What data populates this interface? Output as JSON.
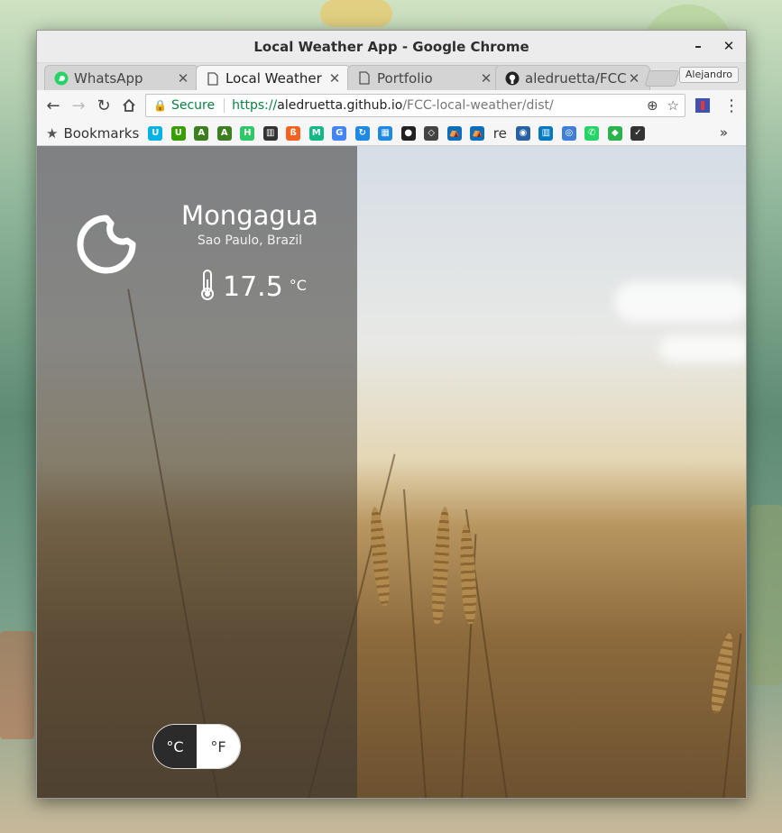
{
  "window": {
    "title": "Local Weather App - Google Chrome",
    "minimize_glyph": "–",
    "close_glyph": "✕"
  },
  "tabs": [
    {
      "label": "WhatsApp",
      "icon": "whatsapp-icon",
      "active": false
    },
    {
      "label": "Local Weather",
      "icon": "page-icon",
      "active": true
    },
    {
      "label": "Portfolio",
      "icon": "page-icon",
      "active": false
    },
    {
      "label": "aledruetta/FCC",
      "icon": "github-icon",
      "active": false
    }
  ],
  "profile_name": "Alejandro",
  "omnibox": {
    "secure_label": "Secure",
    "scheme": "https://",
    "host": "aledruetta.github.io",
    "path": "/FCC-local-weather/dist/"
  },
  "bookmarks": {
    "label": "Bookmarks",
    "reading_item": "re",
    "icons": [
      {
        "name": "udacity-bookmark-icon",
        "color": "#02b3e4",
        "glyph": "U"
      },
      {
        "name": "upwork-bookmark-icon",
        "color": "#37a000",
        "glyph": "U"
      },
      {
        "name": "android-bookmark-icon",
        "color": "#3b7f1f",
        "glyph": "A"
      },
      {
        "name": "android-bookmark-icon-2",
        "color": "#3b7f1f",
        "glyph": "A"
      },
      {
        "name": "hackerrank-bookmark-icon",
        "color": "#2ec866",
        "glyph": "H"
      },
      {
        "name": "app-bookmark-icon",
        "color": "#333333",
        "glyph": "▥"
      },
      {
        "name": "orange-bookmark-icon",
        "color": "#f26322",
        "glyph": "ß"
      },
      {
        "name": "medium-bookmark-icon",
        "color": "#12b886",
        "glyph": "M"
      },
      {
        "name": "translate-bookmark-icon",
        "color": "#4285f4",
        "glyph": "G"
      },
      {
        "name": "sync-bookmark-icon",
        "color": "#1e88e5",
        "glyph": "↻"
      },
      {
        "name": "layout-bookmark-icon",
        "color": "#1e88e5",
        "glyph": "▦"
      },
      {
        "name": "github-bookmark-icon",
        "color": "#222222",
        "glyph": "●"
      },
      {
        "name": "codepen-bookmark-icon",
        "color": "#444444",
        "glyph": "◇"
      },
      {
        "name": "freecodecamp-bookmark-icon",
        "color": "#0a6ebd",
        "glyph": "⛺"
      },
      {
        "name": "freecodecamp-bookmark-icon-2",
        "color": "#0a6ebd",
        "glyph": "⛺"
      }
    ],
    "icons_after": [
      {
        "name": "bucket-bookmark-icon",
        "color": "#2962a0",
        "glyph": "◉"
      },
      {
        "name": "trello-bookmark-icon",
        "color": "#0079bf",
        "glyph": "▥"
      },
      {
        "name": "globe-bookmark-icon",
        "color": "#3f7fd8",
        "glyph": "◎"
      },
      {
        "name": "whatsapp-bookmark-icon",
        "color": "#25d366",
        "glyph": "✆"
      },
      {
        "name": "feedly-bookmark-icon",
        "color": "#2bb24c",
        "glyph": "◆"
      },
      {
        "name": "bird-bookmark-icon",
        "color": "#333333",
        "glyph": "✓"
      }
    ],
    "more_glyph": "»"
  },
  "weather": {
    "city": "Mongagua",
    "region": "Sao Paulo, Brazil",
    "temperature": "17.5",
    "unit": "°C",
    "condition_icon": "night-moon-icon"
  },
  "unit_toggle": {
    "celsius_label": "°C",
    "fahrenheit_label": "°F",
    "selected": "celsius"
  },
  "colors": {
    "secure_green": "#0b8043",
    "toggle_active": "#2b2b2b"
  }
}
